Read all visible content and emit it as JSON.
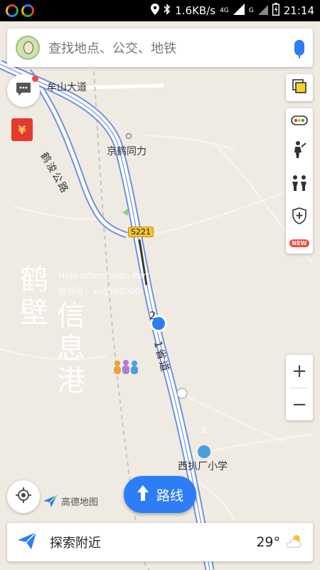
{
  "status_bar": {
    "network_speed": "1.6KB/s",
    "network_type": "4G",
    "signal_label": "G",
    "time": "21:14"
  },
  "search": {
    "placeholder": "查找地点、公交、地铁"
  },
  "map_labels": {
    "road_moushan": "牟山大道",
    "road_hejun": "鹤浚公路",
    "place_jinghe": "京鹤同力",
    "route_shield": "S221",
    "road_shengdao_prefix": "2",
    "road_shengdao": "1省道",
    "school": "西扒厂小学",
    "school_icon_glyph": "文"
  },
  "watermark": {
    "big_text_col1": "鹤壁",
    "big_text_col2": "信息港",
    "line1": "Hebi Information Port",
    "line2": "微信号：xxg958000"
  },
  "tools": {
    "new_badge": "NEW"
  },
  "logo": {
    "text": "高德地图"
  },
  "route_button": {
    "label": "路线"
  },
  "bottom": {
    "nearby_label": "探索附近",
    "temperature": "29°"
  }
}
